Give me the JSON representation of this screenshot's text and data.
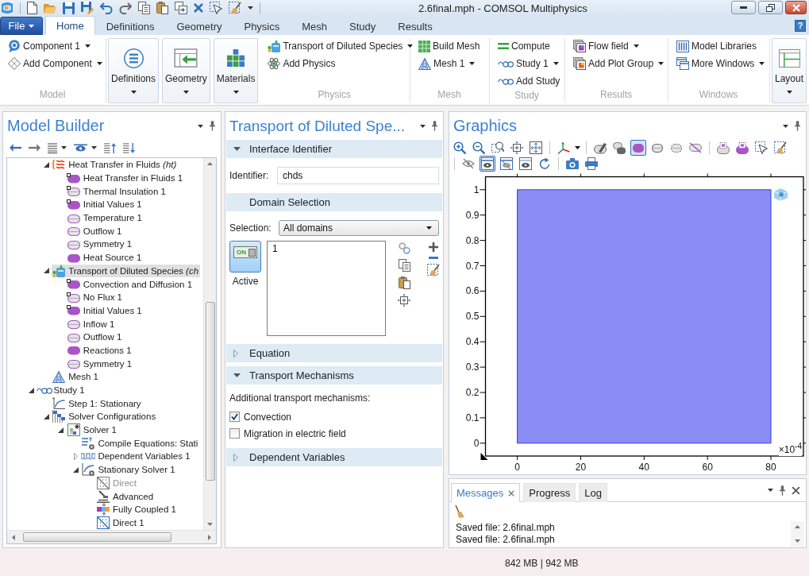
{
  "title_bar": {
    "title": "2.6final.mph - COMSOL Multiphysics"
  },
  "tab_strip": {
    "file": "File",
    "tabs": [
      {
        "label": "Home",
        "selected": true
      },
      {
        "label": "Definitions",
        "selected": false
      },
      {
        "label": "Geometry",
        "selected": false
      },
      {
        "label": "Physics",
        "selected": false
      },
      {
        "label": "Mesh",
        "selected": false
      },
      {
        "label": "Study",
        "selected": false
      },
      {
        "label": "Results",
        "selected": false
      }
    ],
    "help": "?"
  },
  "ribbon": {
    "groups": [
      {
        "label": "Model",
        "items": [
          {
            "kind": "small",
            "label": "Component 1",
            "dropdown": true
          },
          {
            "kind": "small",
            "label": "Add Component",
            "dropdown": true
          }
        ]
      },
      {
        "label": "Physics",
        "items": [
          {
            "kind": "big",
            "label": "Definitions",
            "dropdown": true
          },
          {
            "kind": "big",
            "label": "Geometry",
            "dropdown": true
          },
          {
            "kind": "big",
            "label": "Materials",
            "dropdown": true
          },
          {
            "kind": "small",
            "label": "Transport of Diluted Species",
            "dropdown": true
          },
          {
            "kind": "small",
            "label": "Add Physics",
            "dropdown": false
          }
        ]
      },
      {
        "label": "Mesh",
        "items": [
          {
            "kind": "small",
            "label": "Build Mesh",
            "dropdown": false
          },
          {
            "kind": "small",
            "label": "Mesh 1",
            "dropdown": true
          }
        ]
      },
      {
        "label": "Study",
        "items": [
          {
            "kind": "small",
            "label": "Compute",
            "dropdown": false
          },
          {
            "kind": "small",
            "label": "Study 1",
            "dropdown": true
          },
          {
            "kind": "small",
            "label": "Add Study",
            "dropdown": false
          }
        ]
      },
      {
        "label": "Results",
        "items": [
          {
            "kind": "small",
            "label": "Flow field",
            "dropdown": true
          },
          {
            "kind": "small",
            "label": "Add Plot Group",
            "dropdown": true
          }
        ]
      },
      {
        "label": "Windows",
        "items": [
          {
            "kind": "small",
            "label": "Model Libraries",
            "dropdown": false
          },
          {
            "kind": "small",
            "label": "More Windows",
            "dropdown": true
          }
        ]
      },
      {
        "items": [
          {
            "kind": "big",
            "label": "Layout",
            "dropdown": true
          }
        ]
      }
    ]
  },
  "model_builder": {
    "title": "Model Builder",
    "tree": [
      {
        "children": [
          {
            "label": "Heat Transfer in Fluids *(ht)*",
            "kind": "heat",
            "selected": false,
            "disabled": false,
            "expanded": true,
            "children": [
              {
                "label": "Heat Transfer in Fluids 1",
                "kind": "domain",
                "default": true,
                "selected": false,
                "disabled": false
              },
              {
                "label": "Thermal Insulation 1",
                "kind": "boundary",
                "default": true,
                "selected": false,
                "disabled": false
              },
              {
                "label": "Initial Values 1",
                "kind": "domain",
                "default": true,
                "selected": false,
                "disabled": false
              },
              {
                "label": "Temperature 1",
                "kind": "boundary",
                "default": false,
                "selected": false,
                "disabled": false
              },
              {
                "label": "Outflow 1",
                "kind": "boundary",
                "default": false,
                "selected": false,
                "disabled": false
              },
              {
                "label": "Symmetry 1",
                "kind": "boundary",
                "default": false,
                "selected": false,
                "disabled": false
              },
              {
                "label": "Heat Source 1",
                "kind": "domain",
                "default": false,
                "selected": false,
                "disabled": false
              }
            ]
          },
          {
            "label": "Transport of Diluted Species *(ch*",
            "kind": "species",
            "selected": true,
            "disabled": false,
            "expanded": true,
            "children": [
              {
                "label": "Convection and Diffusion 1",
                "kind": "domain",
                "default": true,
                "selected": false,
                "disabled": false
              },
              {
                "label": "No Flux 1",
                "kind": "boundary",
                "default": true,
                "selected": false,
                "disabled": false
              },
              {
                "label": "Initial Values 1",
                "kind": "domain",
                "default": true,
                "selected": false,
                "disabled": false
              },
              {
                "label": "Inflow 1",
                "kind": "boundary",
                "default": false,
                "selected": false,
                "disabled": false
              },
              {
                "label": "Outflow 1",
                "kind": "boundary",
                "default": false,
                "selected": false,
                "disabled": false
              },
              {
                "label": "Reactions 1",
                "kind": "domain",
                "default": false,
                "selected": false,
                "disabled": false
              },
              {
                "label": "Symmetry 1",
                "kind": "boundary",
                "default": false,
                "selected": false,
                "disabled": false
              }
            ]
          },
          {
            "label": "Mesh 1",
            "kind": "mesh",
            "selected": false,
            "disabled": false
          }
        ]
      },
      {
        "label": "Study 1",
        "kind": "study",
        "selected": false,
        "disabled": false,
        "expanded": true,
        "children": [
          {
            "label": "Step 1: Stationary",
            "kind": "step",
            "selected": false,
            "disabled": false
          },
          {
            "label": "Solver Configurations",
            "kind": "solvers",
            "selected": false,
            "disabled": false,
            "expanded": true,
            "children": [
              {
                "label": "Solver 1",
                "kind": "solver",
                "selected": false,
                "disabled": false,
                "expanded": true,
                "children": [
                  {
                    "label": "Compile Equations: Stati",
                    "kind": "compile",
                    "selected": false,
                    "disabled": false
                  },
                  {
                    "label": "Dependent Variables 1",
                    "kind": "variables",
                    "selected": false,
                    "disabled": false,
                    "expanded": false
                  },
                  {
                    "label": "Stationary Solver 1",
                    "kind": "stationary",
                    "selected": false,
                    "disabled": false,
                    "expanded": true,
                    "children": [
                      {
                        "label": "Direct",
                        "kind": "direct",
                        "selected": false,
                        "disabled": true
                      },
                      {
                        "label": "Advanced",
                        "kind": "advanced",
                        "selected": false,
                        "disabled": false
                      },
                      {
                        "label": "Fully Coupled 1",
                        "kind": "coupled",
                        "selected": false,
                        "disabled": false
                      },
                      {
                        "label": "Direct 1",
                        "kind": "direct",
                        "selected": false,
                        "disabled": false
                      }
                    ]
                  }
                ]
              }
            ]
          }
        ]
      }
    ]
  },
  "settings": {
    "title": "Transport of Diluted Spe...",
    "sections": [
      {
        "kind": "identifier",
        "title": "Interface Identifier",
        "expanded": true,
        "label": "Identifier:",
        "value": "chds"
      },
      {
        "kind": "selection",
        "title": "Domain Selection",
        "label": "Selection:",
        "value": "All domains",
        "toggle": {
          "switch_text": "ON",
          "label": "Active",
          "on": true
        },
        "entries": [
          "1"
        ]
      },
      {
        "kind": "plain",
        "title": "Equation",
        "expanded": false
      },
      {
        "kind": "checks",
        "title": "Transport Mechanisms",
        "expanded": true,
        "caption": "Additional transport mechanisms:",
        "options": [
          {
            "label": "Convection",
            "checked": true
          },
          {
            "label": "Migration in electric field",
            "checked": false
          }
        ]
      },
      {
        "kind": "plain",
        "title": "Dependent Variables",
        "expanded": false
      }
    ]
  },
  "graphics": {
    "title": "Graphics",
    "toolbar": [
      [
        [
          {
            "kind": "zoomin",
            "selected": false
          },
          {
            "kind": "zoomout",
            "selected": false
          },
          {
            "kind": "zoombox",
            "selected": false
          },
          {
            "kind": "zoomselected",
            "selected": false
          },
          {
            "kind": "zoomextents",
            "selected": false
          }
        ],
        [
          {
            "kind": "axes",
            "selected": false
          }
        ],
        [
          {
            "kind": "transparency",
            "selected": false
          },
          {
            "kind": "scenelight",
            "selected": false
          },
          {
            "kind": "seldomain",
            "selected": true
          },
          {
            "kind": "selboundary",
            "selected": false
          },
          {
            "kind": "seledge",
            "selected": false
          },
          {
            "kind": "hidepill",
            "selected": false
          }
        ],
        [
          {
            "kind": "pillbox",
            "selected": false
          },
          {
            "kind": "purplebox",
            "selected": false
          },
          {
            "kind": "selectbox",
            "selected": false
          },
          {
            "kind": "broombox",
            "selected": false
          }
        ]
      ],
      [
        [
          {
            "kind": "hide",
            "selected": false
          },
          {
            "kind": "show",
            "selected": true
          },
          {
            "kind": "hidesel",
            "selected": false
          },
          {
            "kind": "showsel",
            "selected": false
          },
          {
            "kind": "reset",
            "selected": false
          }
        ],
        [
          {
            "kind": "camera",
            "selected": false
          },
          {
            "kind": "printer",
            "selected": false
          }
        ]
      ]
    ],
    "plot": {
      "y_ticks": [
        "1",
        "0.9",
        "0.8",
        "0.7",
        "0.6",
        "0.5",
        "0.4",
        "0.3",
        "0.2",
        "0.1",
        "0"
      ],
      "x_ticks": [
        "0",
        "20",
        "40",
        "60",
        "80"
      ],
      "multiplier": "×10$^{-4}$"
    }
  },
  "messages": {
    "tabs": [
      {
        "label": "Messages",
        "selected": true,
        "closable": true
      },
      {
        "label": "Progress",
        "selected": false,
        "closable": false
      },
      {
        "label": "Log",
        "selected": false,
        "closable": false
      }
    ],
    "lines": [
      "Saved file: 2.6final.mph",
      "Saved file: 2.6final.mph"
    ]
  },
  "status_bar": {
    "memory": "842 MB | 942 MB"
  }
}
